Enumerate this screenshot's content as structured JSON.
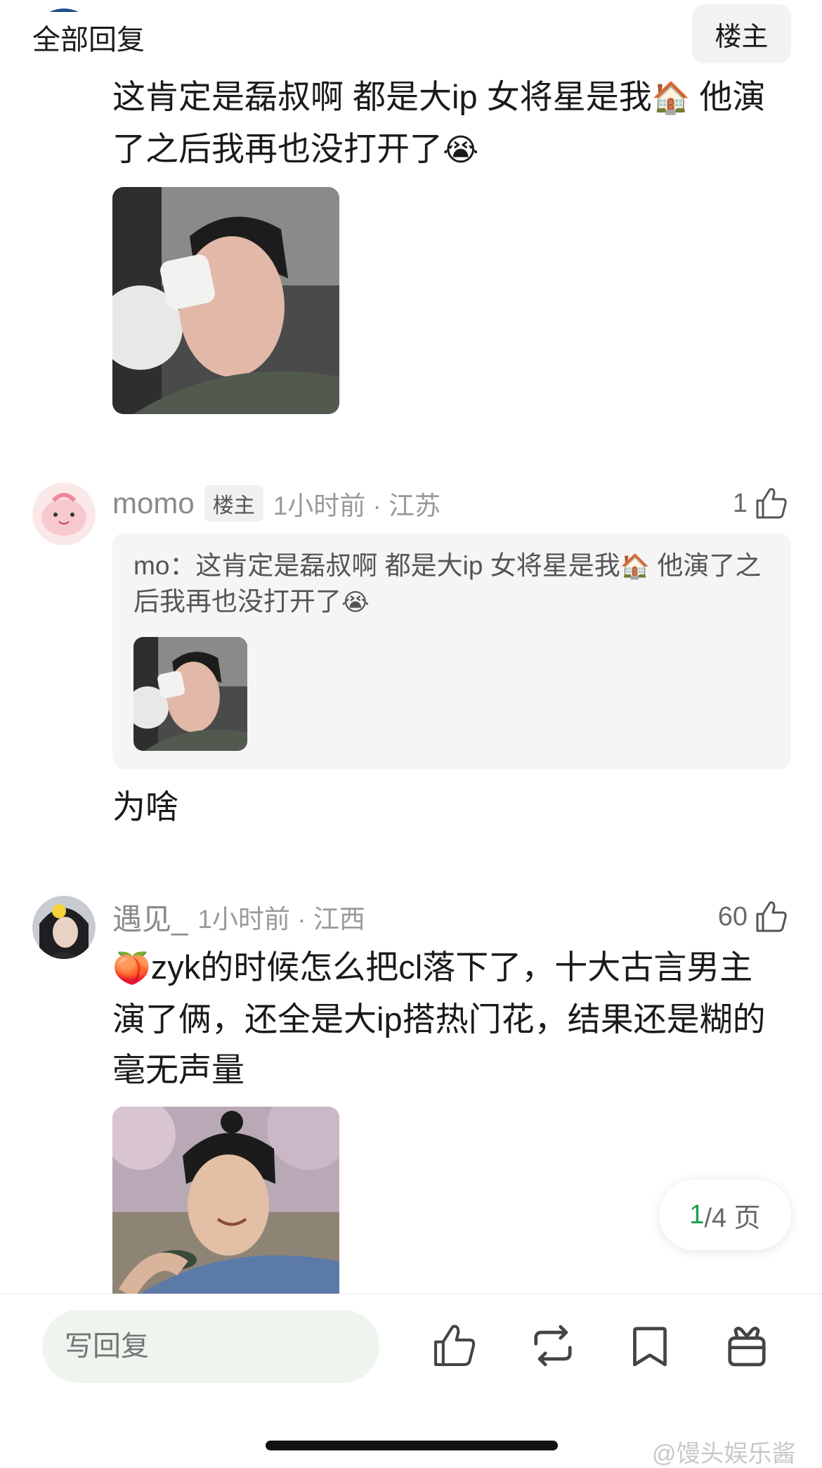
{
  "header": {
    "title": "全部回复",
    "op_filter": "楼主"
  },
  "comment1": {
    "text_1": "这肯定是磊叔啊 都是大ip 女将星是我",
    "emoji_1": "🏠",
    "text_2": " 他演了之后我再也没打开了",
    "emoji_2": "😭"
  },
  "comment2": {
    "username": "momo",
    "badge": "楼主",
    "time_location": "1小时前 · 江苏",
    "likes": "1",
    "quote": {
      "text_1": "mo：这肯定是磊叔啊 都是大ip 女将星是我",
      "emoji_1": "🏠",
      "text_2": " 他演了之后我再也没打开了",
      "emoji_2": "😭"
    },
    "text": "为啥"
  },
  "comment3": {
    "username": "遇见_",
    "time_location": "1小时前 · 江西",
    "likes": "60",
    "emoji": "🍑",
    "text": "zyk的时候怎么把cl落下了，十大古言男主演了俩，还全是大ip搭热门花，结果还是糊的毫无声量"
  },
  "pager": {
    "current": "1",
    "rest": "/4 页"
  },
  "bottom_bar": {
    "reply_placeholder": "写回复",
    "icons": [
      "thumbs-up-icon",
      "repost-icon",
      "bookmark-icon",
      "gift-icon"
    ]
  },
  "watermark": "@馒头娱乐酱",
  "colors": {
    "accent_green": "#1f9e4f",
    "input_bg": "#eef5ef"
  }
}
